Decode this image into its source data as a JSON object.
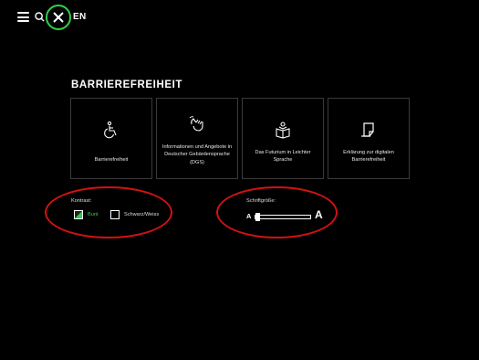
{
  "header": {
    "lang_label": "EN",
    "menu_icon": "hamburger-menu-icon",
    "search_icon": "search-icon",
    "close_icon": "close-icon",
    "close_ring_color": "#2fd04a"
  },
  "page": {
    "title": "BARRIEREFREIHEIT"
  },
  "tiles": [
    {
      "icon": "wheelchair-icon",
      "label": "Barrierefreiheit"
    },
    {
      "icon": "sign-language-icon",
      "label": "Informationen und Angebote in Deutscher Gebärdensprache (DGS)"
    },
    {
      "icon": "easy-language-icon",
      "label": "Das Futurium in Leichter Sprache"
    },
    {
      "icon": "document-icon",
      "label": "Erklärung zur digitalen Barrierefreiheit"
    }
  ],
  "contrast": {
    "label": "Kontrast:",
    "options": [
      {
        "label": "Bunt",
        "selected": true,
        "color": "#2fd04a"
      },
      {
        "label": "Schwarz/Weiss",
        "selected": false
      }
    ]
  },
  "font_size": {
    "label": "Schriftgröße:",
    "small_glyph": "A",
    "large_glyph": "A",
    "level": 0.0
  },
  "annotation_color": "#d11212"
}
